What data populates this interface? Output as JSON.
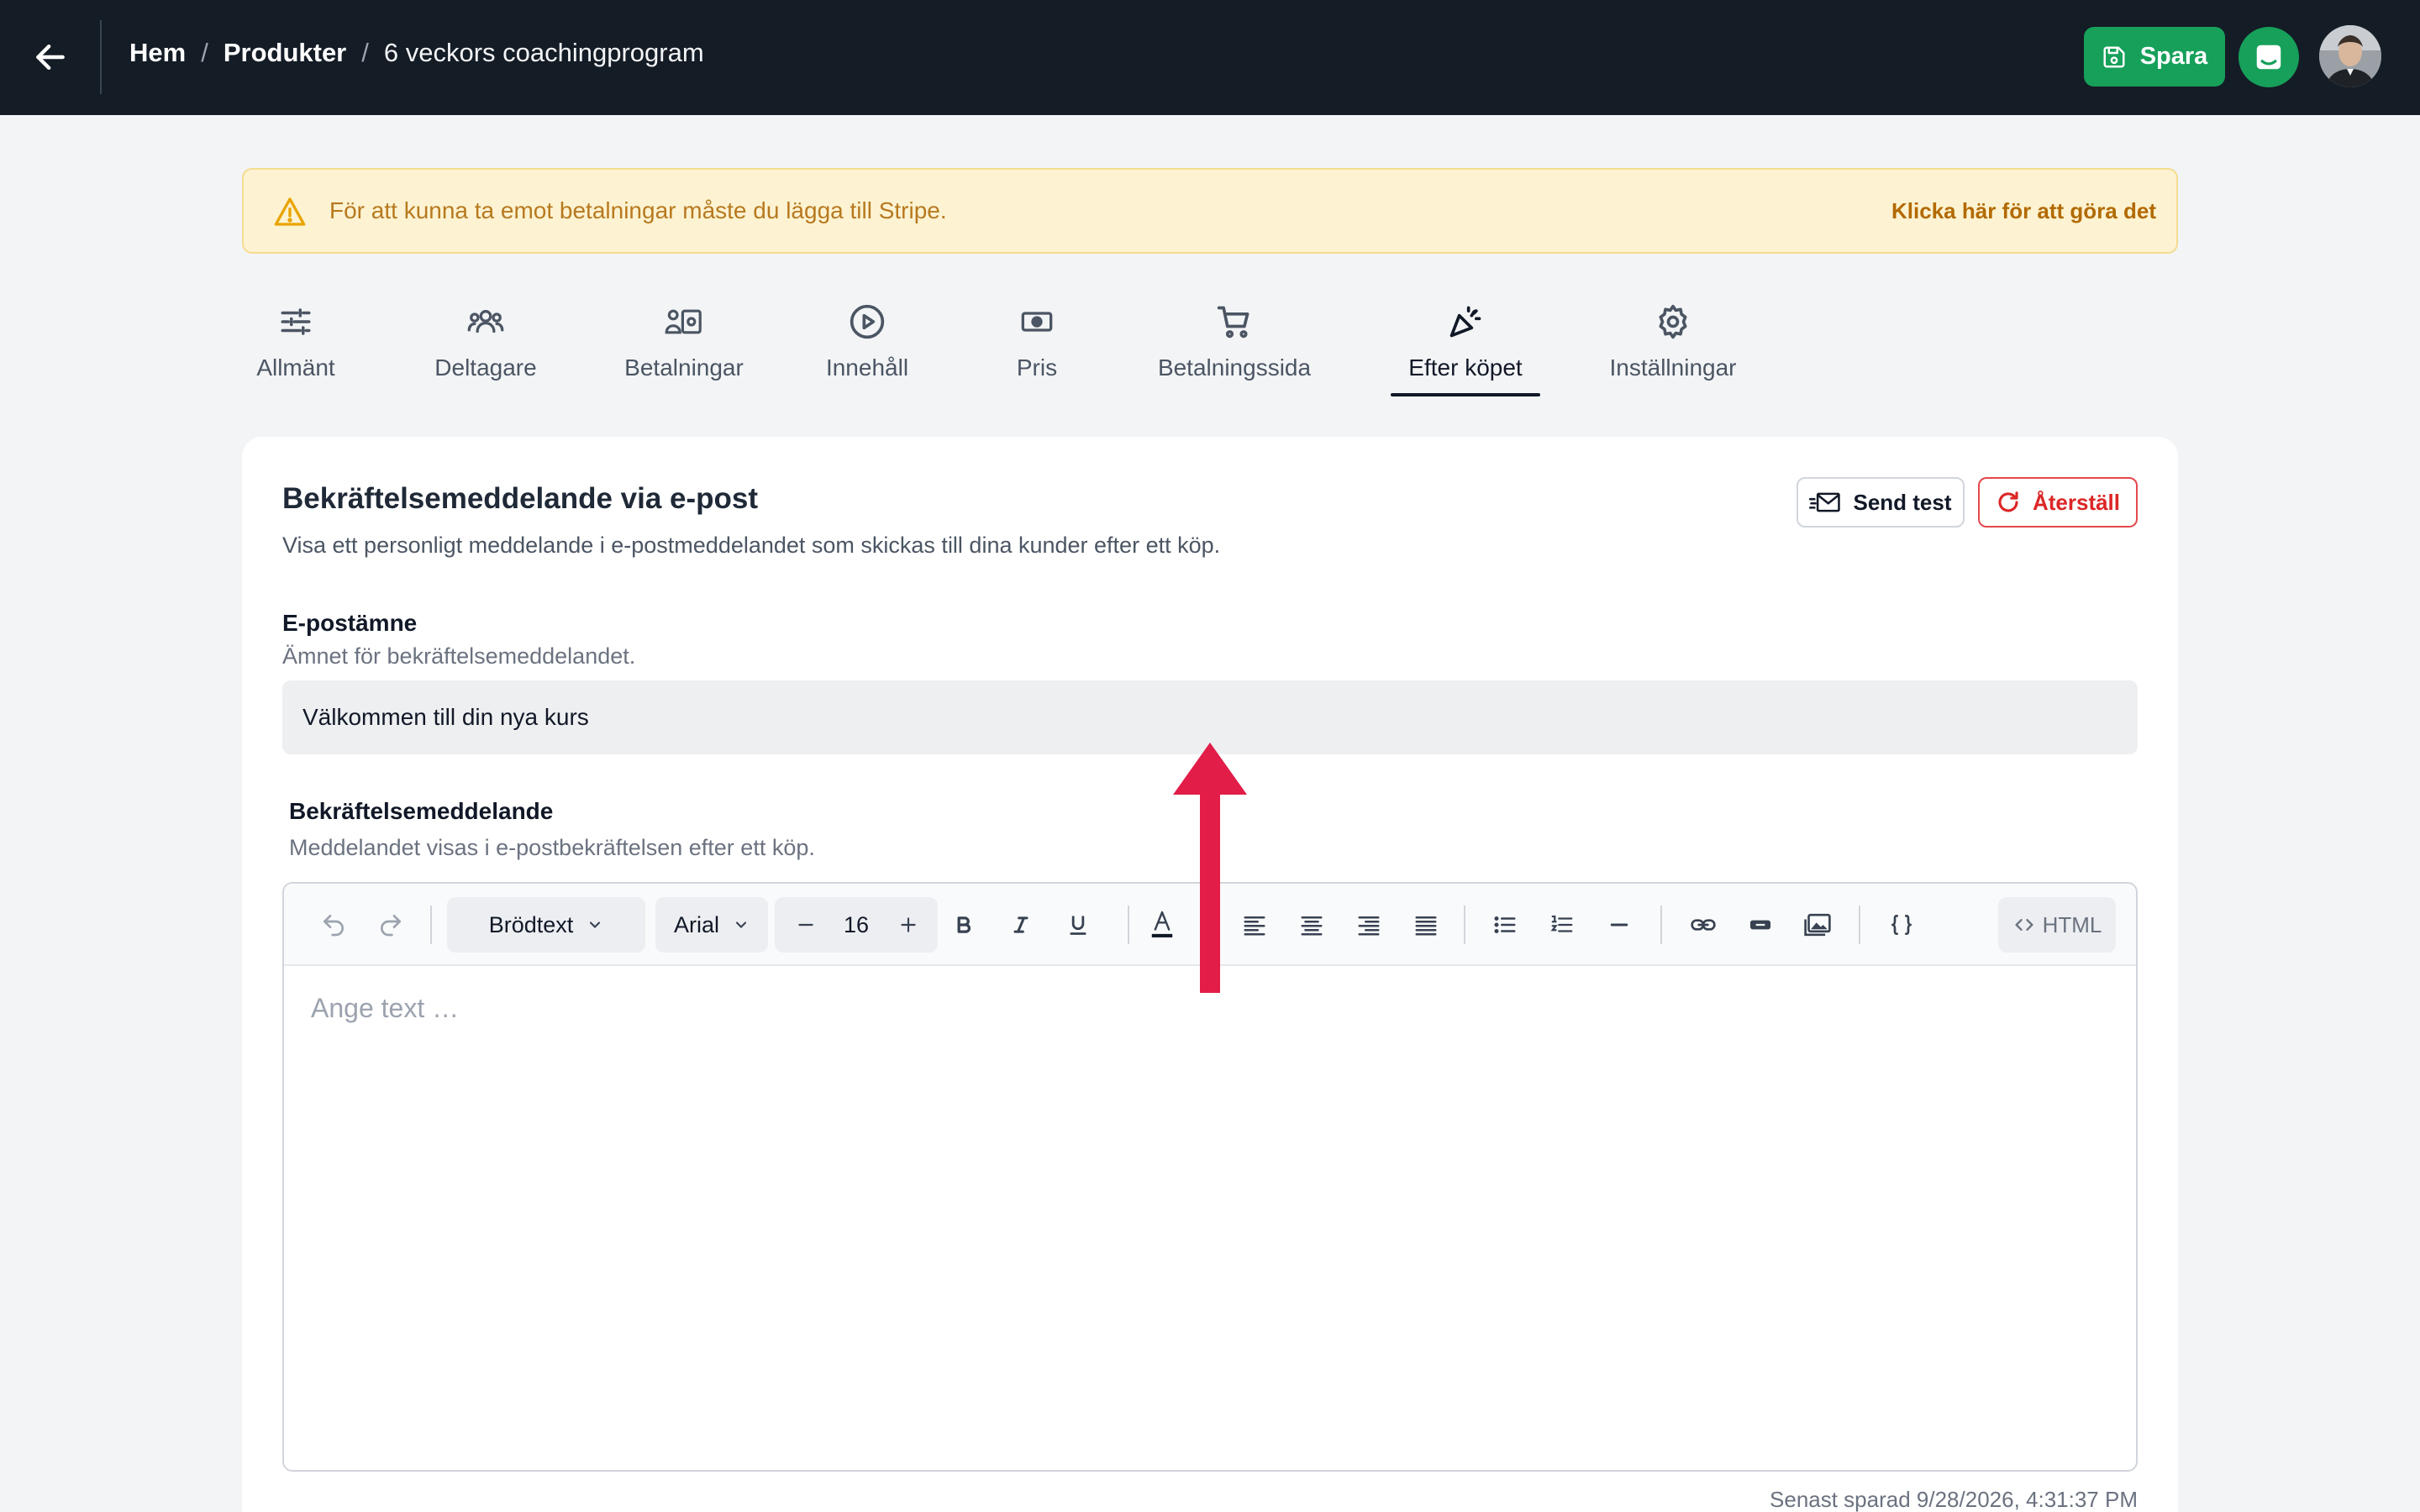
{
  "header": {
    "breadcrumb": {
      "home": "Hem",
      "separator": "/",
      "products": "Produkter",
      "current": "6 veckors coachingprogram"
    },
    "save_label": "Spara",
    "accent_color": "#16a05a",
    "bar_color": "#141c26"
  },
  "alert": {
    "text": "För att kunna ta emot betalningar måste du lägga till Stripe.",
    "action": "Klicka här för att göra det"
  },
  "tabs": [
    {
      "label": "Allmänt",
      "icon": "sliders-icon"
    },
    {
      "label": "Deltagare",
      "icon": "users-icon"
    },
    {
      "label": "Betalningar",
      "icon": "payments-icon"
    },
    {
      "label": "Innehåll",
      "icon": "play-circle-icon"
    },
    {
      "label": "Pris",
      "icon": "cash-icon"
    },
    {
      "label": "Betalningssida",
      "icon": "cart-icon"
    },
    {
      "label": "Efter köpet",
      "icon": "party-icon",
      "active": true
    },
    {
      "label": "Inställningar",
      "icon": "gear-icon"
    }
  ],
  "card": {
    "title": "Bekräftelsemeddelande via e-post",
    "description": "Visa ett personligt meddelande i e-postmeddelandet som skickas till dina kunder efter ett köp.",
    "send_test_label": "Send test",
    "reset_label": "Återställ"
  },
  "subject": {
    "label": "E-postämne",
    "help": "Ämnet för bekräftelsemeddelandet.",
    "value": "Välkommen till din nya kurs"
  },
  "message": {
    "label": "Bekräftelsemeddelande",
    "help": "Meddelandet visas i e-postbekräftelsen efter ett köp."
  },
  "toolbar": {
    "block_style": "Brödtext",
    "font_family": "Arial",
    "font_size": "16",
    "html_label": "HTML"
  },
  "editor": {
    "placeholder": "Ange text …"
  },
  "footer": {
    "last_saved": "Senast sparad 9/28/2026, 4:31:37 PM"
  },
  "annotation_color": "#e11d48"
}
